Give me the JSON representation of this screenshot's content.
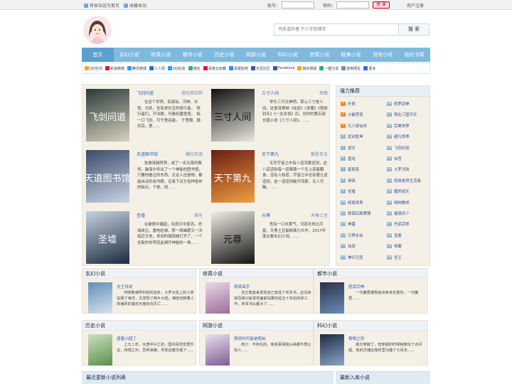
{
  "topbar": {
    "set_home": "将本站设为首页",
    "bookmark": "收藏本站",
    "account_label": "账号：",
    "password_label": "密码：",
    "login": "登 录",
    "register": "用户注册"
  },
  "search": {
    "placeholder": "书名或作者,宁少字别错字",
    "button": "搜 索"
  },
  "nav": [
    "首页",
    "玄幻小说",
    "修真小说",
    "都市小说",
    "历史小说",
    "网游小说",
    "科幻小说",
    "言情小说",
    "耽美小说",
    "其他小说",
    "临时书架"
  ],
  "share": [
    "QQ空间",
    "新浪微博",
    "腾讯微博",
    "人人网",
    "QQ好友",
    "微信",
    "百度云收藏",
    "百度贴吧",
    "天涯社区",
    "Facebook",
    "我的搜狐",
    "一键分享",
    "复制网址",
    "更多"
  ],
  "share_colors": [
    "#f5a623",
    "#e6162d",
    "#2f9ee6",
    "#1e73be",
    "#2f9ee6",
    "#32b16c",
    "#e6162d",
    "#3388ff",
    "#3b5998",
    "#3b5998",
    "#f5a623",
    "#32b16c",
    "#888",
    "#2f6fd0"
  ],
  "featured": [
    {
      "title": "飞剑问道",
      "author": "我吃西红柿",
      "desc": "在这个世界，有狐仙、河神、水怪、大妖，也有求长生的修行者。　修行者们，开法眼，可看妖魔鬼怪。　练一口飞剑，可千里杀敌。　千里眼、顺风耳，更......"
    },
    {
      "title": "三寸人间",
      "author": "耳根",
      "desc": "举头三尺无神明，掌心三寸是人间。这是耳根继《仙逆》《求魔》《我欲封天》《一念永恒》后，创作的第五部长篇小说《三寸人间》。......"
    },
    {
      "title": "天道图书馆",
      "author": "横扫天涯",
      "desc": "张悬穿越异界，成了一名光荣的教师，脑海中多出了一个神秘的图书馆。只要他看过的东西，无论人还是物，都能自动形成书籍，记录下对方各种各样的缺点，于是，他......"
    },
    {
      "title": "天下第九",
      "author": "鹅是老五",
      "desc": "无尽宇宙之中有八道鸿蒙道则，这八道道则每一道都铸一个无上道者翻身。没有人知道，宇宙之中还有第九道道则，这一道道则破开鸿蒙，无人可触。......"
    },
    {
      "title": "圣墟",
      "author": "辰东",
      "desc": "在破败中崛起，在寂灭中复苏。沧海成尘，雷电枯竭，那一缕幽雾又一次临近大地，世间的枷锁被打开了，一个全新的世界就此揭开神秘的一角......"
    },
    {
      "title": "元尊",
      "author": "天蚕土豆",
      "desc": "吾有一口玄黄气，可吞天地日月星。天蚕土豆最新鼎力大作，2017年度必看玄幻小说。......"
    }
  ],
  "rank": {
    "title": "强力推荐",
    "left": [
      "升邪",
      "斗破苍穹",
      "凡人修仙传",
      "武动乾坤",
      "遮天",
      "盘龙",
      "星辰变",
      "琴帝",
      "圣墟",
      "修真世界",
      "修真后面摩擦",
      "神墓",
      "万界永仙",
      "仙逆",
      "神印王座"
    ],
    "right": [
      "修罗武神",
      "我在三国开天",
      "完美世界",
      "超凡世界",
      "飞剑问道",
      "仙宫",
      "斗罗大陆",
      "修真老师生活录",
      "魔师逆天",
      "特种教师",
      "最强兵少",
      "丹武宗师",
      "宝鉴",
      "帝霸",
      "圣王"
    ]
  },
  "sections": [
    {
      "name": "玄幻小说",
      "book": "龙王传说",
      "desc": "伴随着魂导科技的进步，斗罗大陆上的人类征服了海洋，又发现了两片大陆。魂兽也随着人类魂师的猎杀无度走向灭亡......"
    },
    {
      "name": "修真小说",
      "book": "修真高手",
      "desc": "当王角爸来发现自己变成了宋青书，还没来得及高兴就发现面前站着的是五十年后的张三丰，宋青书头都大了......"
    },
    {
      "name": "都市小说",
      "book": "医武宗神",
      "desc": "一代魔君遭叛徒出卖身负重伤，一代魔君......"
    },
    {
      "name": "历史小说",
      "book": "盛唐小园丁",
      "desc": "上元二年，大唐中兴之初，国内百姓安居乐业，四境之外，异邦来朝，然而这繁华底下......"
    },
    {
      "name": "网游小说",
      "book": "我修的可能是假仙",
      "desc": "简介：不存在的，有些事情我从来都不想让别人......"
    },
    {
      "name": "科幻小说",
      "book": "黎明之剑",
      "desc": "高文穿越了，但穿越的时候稍微出了点问题，他的灵魂在棺材里沉睡了七百年......"
    }
  ],
  "bottom": {
    "latest": "最近更新小说列表",
    "newest": "最新入库小说"
  }
}
